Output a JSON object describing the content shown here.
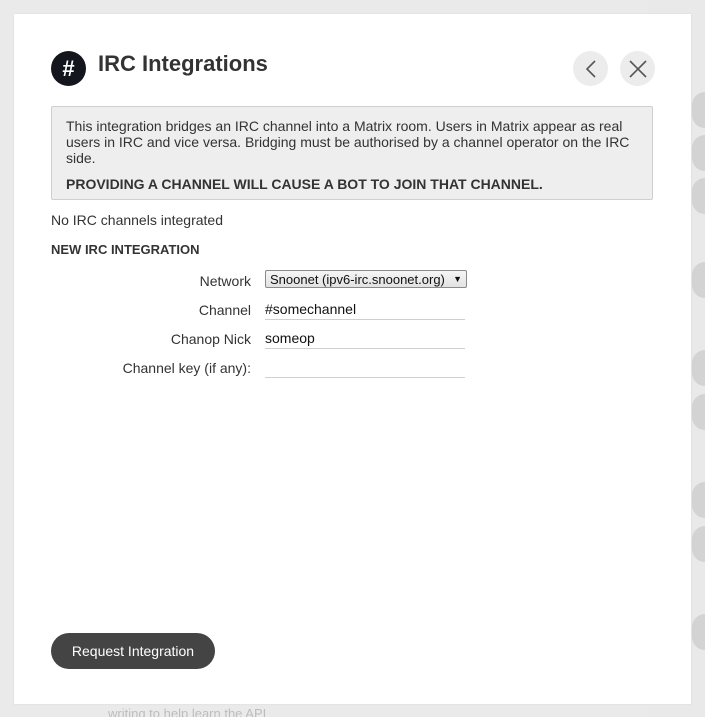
{
  "background": {
    "footer_text": "writing to help learn the API"
  },
  "modal": {
    "header": {
      "icon": "hash-icon",
      "icon_glyph": "#",
      "title": "IRC Integrations",
      "back_icon": "chevron-left-icon",
      "close_icon": "close-icon"
    },
    "info": {
      "text": "This integration bridges an IRC channel into a Matrix room. Users in Matrix appear as real users in IRC and vice versa. Bridging must be authorised by a channel operator on the IRC side.",
      "warning": "PROVIDING A CHANNEL WILL CAUSE A BOT TO JOIN THAT CHANNEL."
    },
    "status_text": "No IRC channels integrated",
    "section_heading": "NEW IRC INTEGRATION",
    "form": {
      "network": {
        "label": "Network",
        "selected": "Snoonet (ipv6-irc.snoonet.org)",
        "arrow_icon": "dropdown-arrow-icon"
      },
      "channel": {
        "label": "Channel",
        "value": "#somechannel"
      },
      "chanop_nick": {
        "label": "Chanop Nick",
        "value": "someop"
      },
      "channel_key": {
        "label": "Channel key (if any):",
        "value": ""
      }
    },
    "submit_label": "Request Integration"
  },
  "colors": {
    "title_text": "#333333",
    "icon_bg": "#13161c",
    "info_bg": "#eeeeee",
    "button_bg": "#444444",
    "button_text": "#ffffff"
  }
}
